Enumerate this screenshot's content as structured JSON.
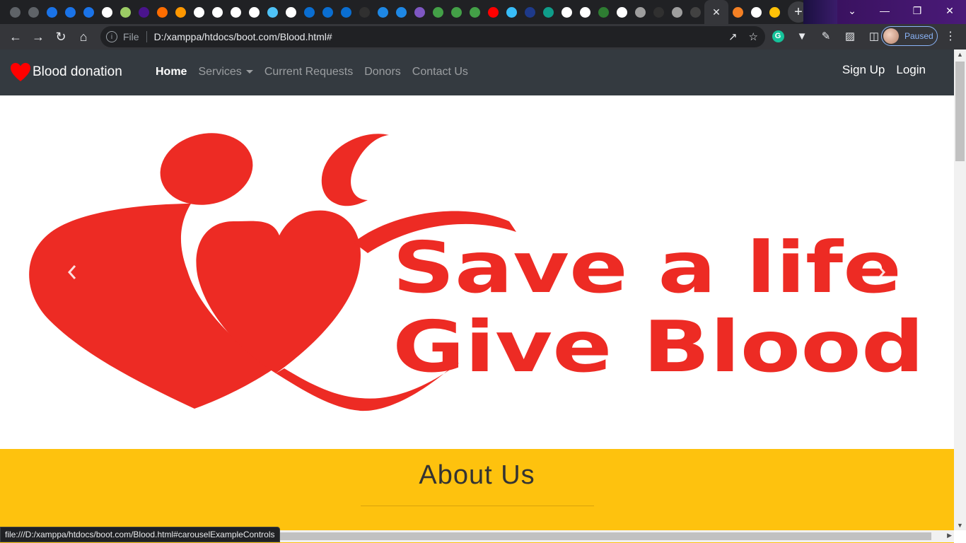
{
  "browser": {
    "url": "D:/xamppa/htdocs/boot.com/Blood.html#",
    "site_info_label": "File",
    "profile_status": "Paused",
    "status_link": "file:///D:/xamppa/htdocs/boot.com/Blood.html#carouselExampleControls",
    "tab_icon_colors": [
      "#5f6368",
      "#5f6368",
      "#1a73e8",
      "#1a73e8",
      "#1a73e8",
      "#ffffff",
      "#9ccc65",
      "#4a148c",
      "#ff6d00",
      "#ff9800",
      "#ffffff",
      "#ffffff",
      "#ffffff",
      "#ffffff",
      "#4fc3f7",
      "#ffffff",
      "#0a6ed1",
      "#0a6ed1",
      "#0a6ed1",
      "#303030",
      "#1e88e5",
      "#1e88e5",
      "#7e57c2",
      "#43a047",
      "#43a047",
      "#43a047",
      "#ff0000",
      "#38bdf8",
      "#1e3a8a",
      "#0f9d8a",
      "#ffffff",
      "#ffffff",
      "#2e7d32",
      "#ffffff",
      "#9e9e9e",
      "#303030",
      "#9e9e9e",
      "#424242"
    ],
    "after_active_icon_colors": [
      "#f48024",
      "#ffffff",
      "#ffc107"
    ]
  },
  "navbar": {
    "brand": "Blood donation",
    "links": [
      "Home",
      "Services",
      "Current Requests",
      "Donors",
      "Contact Us"
    ],
    "right_links": [
      "Sign Up",
      "Login"
    ]
  },
  "hero": {
    "line1": "Save a life",
    "line2": "Give Blood",
    "color": "#ed2b24"
  },
  "about": {
    "title": "About Us",
    "background": "#fec20e"
  }
}
